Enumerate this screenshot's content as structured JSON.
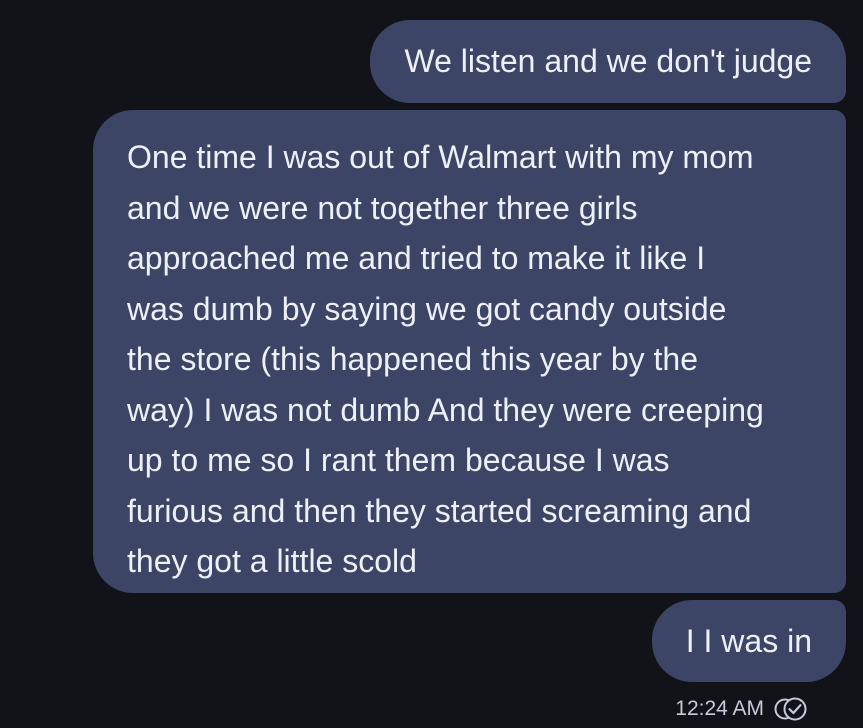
{
  "conversation": {
    "messages": [
      {
        "text": "We listen and we don't judge"
      },
      {
        "lines": [
          "One time I was out of Walmart with my mom",
          "and we were not together three girls",
          "approached me and tried to make it like I",
          "was dumb by saying we got candy outside",
          "the store (this happened this year by the",
          "way) I was not dumb And they were creeping",
          "up to me so I rant them because I was",
          "furious and then they started screaming and",
          "they got a little scold"
        ]
      },
      {
        "text": "I I was in"
      }
    ],
    "timestamp": "12:24 AM",
    "status_icon": "read-receipt-icon"
  },
  "colors": {
    "background": "#121318",
    "bubble": "#3c4566",
    "text": "#eef0f8",
    "meta_text": "#c6cadb"
  }
}
